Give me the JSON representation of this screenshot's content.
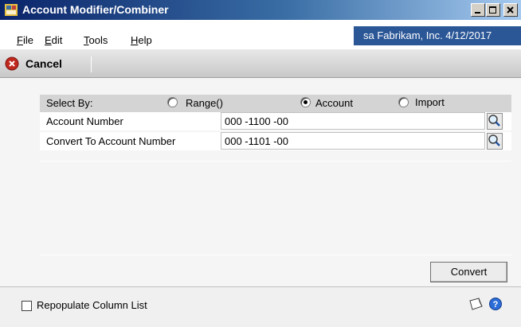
{
  "window": {
    "title": "Account Modifier/Combiner"
  },
  "menu": {
    "items": [
      {
        "label": "File",
        "accel": "F"
      },
      {
        "label": "Edit",
        "accel": "E"
      },
      {
        "label": "Tools",
        "accel": "T"
      },
      {
        "label": "Help",
        "accel": "H"
      }
    ],
    "user_info": "sa  Fabrikam, Inc.  4/12/2017"
  },
  "toolbar": {
    "cancel_label": "Cancel"
  },
  "form": {
    "select_by_label": "Select By:",
    "options": [
      {
        "label": "Range()",
        "selected": false
      },
      {
        "label": "Account",
        "selected": true
      },
      {
        "label": "Import",
        "selected": false
      }
    ],
    "account_number_label": "Account Number",
    "account_number_value": "000 -1100 -00",
    "convert_to_label": "Convert To Account Number",
    "convert_to_value": "000 -1101 -00",
    "convert_button": "Convert"
  },
  "footer": {
    "repopulate_label": "Repopulate Column List",
    "repopulate_checked": false
  },
  "colors": {
    "title_gradient_start": "#0a246a",
    "user_bar": "#2b5797",
    "cancel_red": "#c0281e"
  }
}
